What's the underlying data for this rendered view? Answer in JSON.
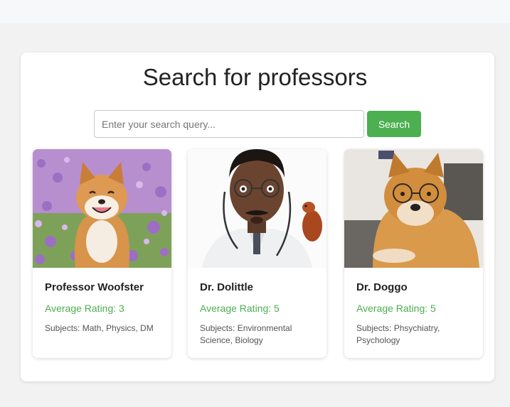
{
  "page": {
    "title": "Search for professors"
  },
  "search": {
    "placeholder": "Enter your search query...",
    "button_label": "Search"
  },
  "professors": [
    {
      "name": "Professor Woofster",
      "rating": "Average Rating: 3",
      "subjects": "Subjects: Math, Physics, DM",
      "photo": "shiba-dog-in-flower-field"
    },
    {
      "name": "Dr. Dolittle",
      "rating": "Average Rating: 5",
      "subjects": "Subjects: Environmental Science, Biology",
      "photo": "doctor-with-stethoscope-and-squirrel"
    },
    {
      "name": "Dr. Doggo",
      "rating": "Average Rating: 5",
      "subjects": "Subjects: Phsychiatry, Psychology",
      "photo": "shiba-dog-wearing-glasses"
    }
  ],
  "colors": {
    "accent": "#4caf50",
    "panel": "#ffffff",
    "background": "#f2f2f2"
  }
}
